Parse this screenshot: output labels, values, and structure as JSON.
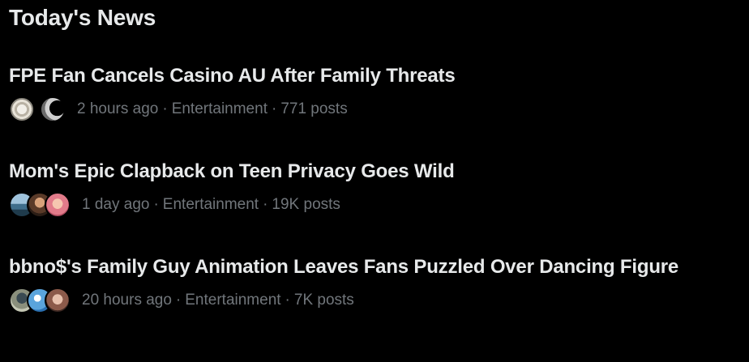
{
  "section": {
    "title": "Today's News"
  },
  "news": [
    {
      "headline": "FPE Fan Cancels Casino AU After Family Threats",
      "time": "2 hours ago",
      "category": "Entertainment",
      "posts": "771 posts",
      "avatars": [
        "avatar-swirl-gray",
        "avatar-moon-dark"
      ]
    },
    {
      "headline": "Mom's Epic Clapback on Teen Privacy Goes Wild",
      "time": "1 day ago",
      "category": "Entertainment",
      "posts": "19K posts",
      "avatars": [
        "avatar-landscape-blue",
        "avatar-portrait-brown",
        "avatar-portrait-pink"
      ]
    },
    {
      "headline": "bbno$'s Family Guy Animation Leaves Fans Puzzled Over Dancing Figure",
      "time": "20 hours ago",
      "category": "Entertainment",
      "posts": "7K posts",
      "avatars": [
        "avatar-portrait-olive",
        "avatar-sky-blue",
        "avatar-portrait-rose"
      ]
    }
  ],
  "colors": {
    "background": "#000000",
    "primary_text": "#e7e9ea",
    "secondary_text": "#71767b"
  }
}
